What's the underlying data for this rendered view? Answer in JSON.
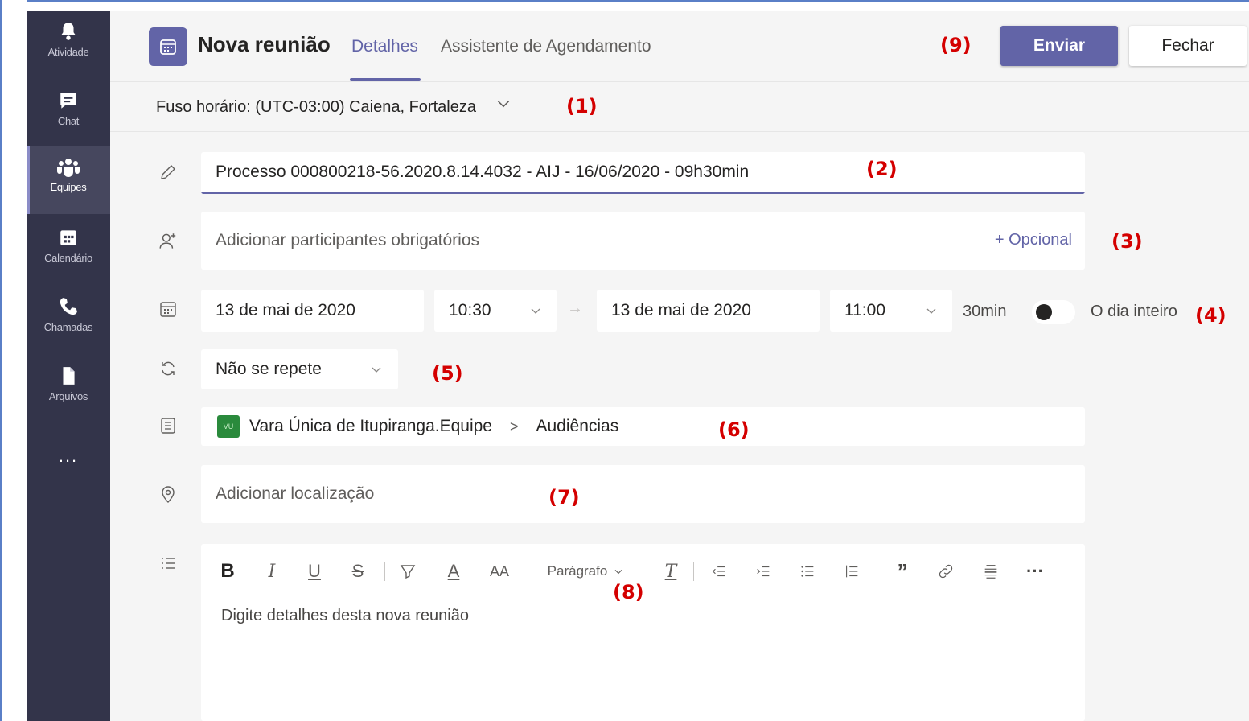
{
  "rail": {
    "items": [
      {
        "label": "Atividade",
        "icon": "bell-icon"
      },
      {
        "label": "Chat",
        "icon": "chat-icon"
      },
      {
        "label": "Equipes",
        "icon": "teams-icon"
      },
      {
        "label": "Calendário",
        "icon": "calendar-icon"
      },
      {
        "label": "Chamadas",
        "icon": "phone-icon"
      },
      {
        "label": "Arquivos",
        "icon": "file-icon"
      }
    ],
    "active": "Equipes",
    "more": "..."
  },
  "header": {
    "title": "Nova reunião",
    "tabs": [
      "Detalhes",
      "Assistente de Agendamento"
    ],
    "active_tab": "Detalhes",
    "send_label": "Enviar",
    "close_label": "Fechar"
  },
  "annotations": {
    "a1": "(1)",
    "a2": "(2)",
    "a3": "(3)",
    "a4": "(4)",
    "a5": "(5)",
    "a6": "(6)",
    "a7": "(7)",
    "a8": "(8)",
    "a9": "(9)"
  },
  "timezone": {
    "label": "Fuso horário: (UTC-03:00) Caiena, Fortaleza"
  },
  "subject": {
    "value": "Processo 000800218-56.2020.8.14.4032 - AIJ - 16/06/2020 - 09h30min"
  },
  "attendees": {
    "placeholder": "Adicionar participantes obrigatórios",
    "optional": "+ Opcional"
  },
  "datetime": {
    "start_date": "13 de mai de 2020",
    "start_time": "10:30",
    "end_date": "13 de mai de 2020",
    "end_time": "11:00",
    "duration": "30min",
    "all_day_label": "O dia inteiro",
    "all_day": false
  },
  "repeat": {
    "value": "Não se repete"
  },
  "channel": {
    "badge": "VU",
    "team": "Vara Única de Itupiranga.Equipe",
    "separator": ">",
    "channel": "Audiências"
  },
  "location": {
    "placeholder": "Adicionar localização"
  },
  "editor": {
    "paragraph_label": "Parágrafo",
    "placeholder": "Digite detalhes desta nova reunião"
  },
  "colors": {
    "accent": "#6264a7",
    "rail": "#33344a",
    "annotation": "#d40000"
  }
}
